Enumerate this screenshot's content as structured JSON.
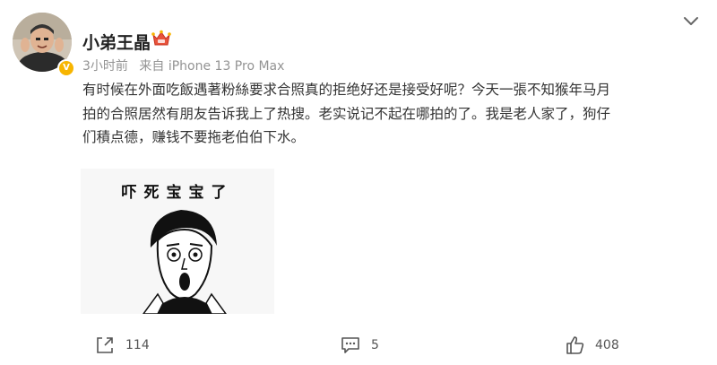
{
  "post": {
    "username": "小弟王晶",
    "time": "3小时前",
    "source": "来自 iPhone 13 Pro Max",
    "content_lines": [
      "有时候在外面吃飯遇著粉絲要求合照真的拒绝好还是接受好呢？今天一張不知猴年马月",
      "拍的合照居然有朋友告诉我上了热搜。老实说记不起在哪拍的了。我是老人家了，狗仔",
      "们積点德，赚钱不要拖老伯伯下水。"
    ],
    "image": {
      "caption": "吓死宝宝了"
    }
  },
  "actions": {
    "share_count": "114",
    "comment_count": "5",
    "like_count": "408"
  },
  "icons": {
    "verified": "yellow-v-badge",
    "level": "crown-badge",
    "more": "chevron-down-icon",
    "share": "share-icon",
    "comment": "comment-icon",
    "like": "thumbs-up-icon"
  },
  "colors": {
    "verified_badge": "#f7b500",
    "meta_text": "#939393",
    "badge_red": "#e8533c"
  }
}
